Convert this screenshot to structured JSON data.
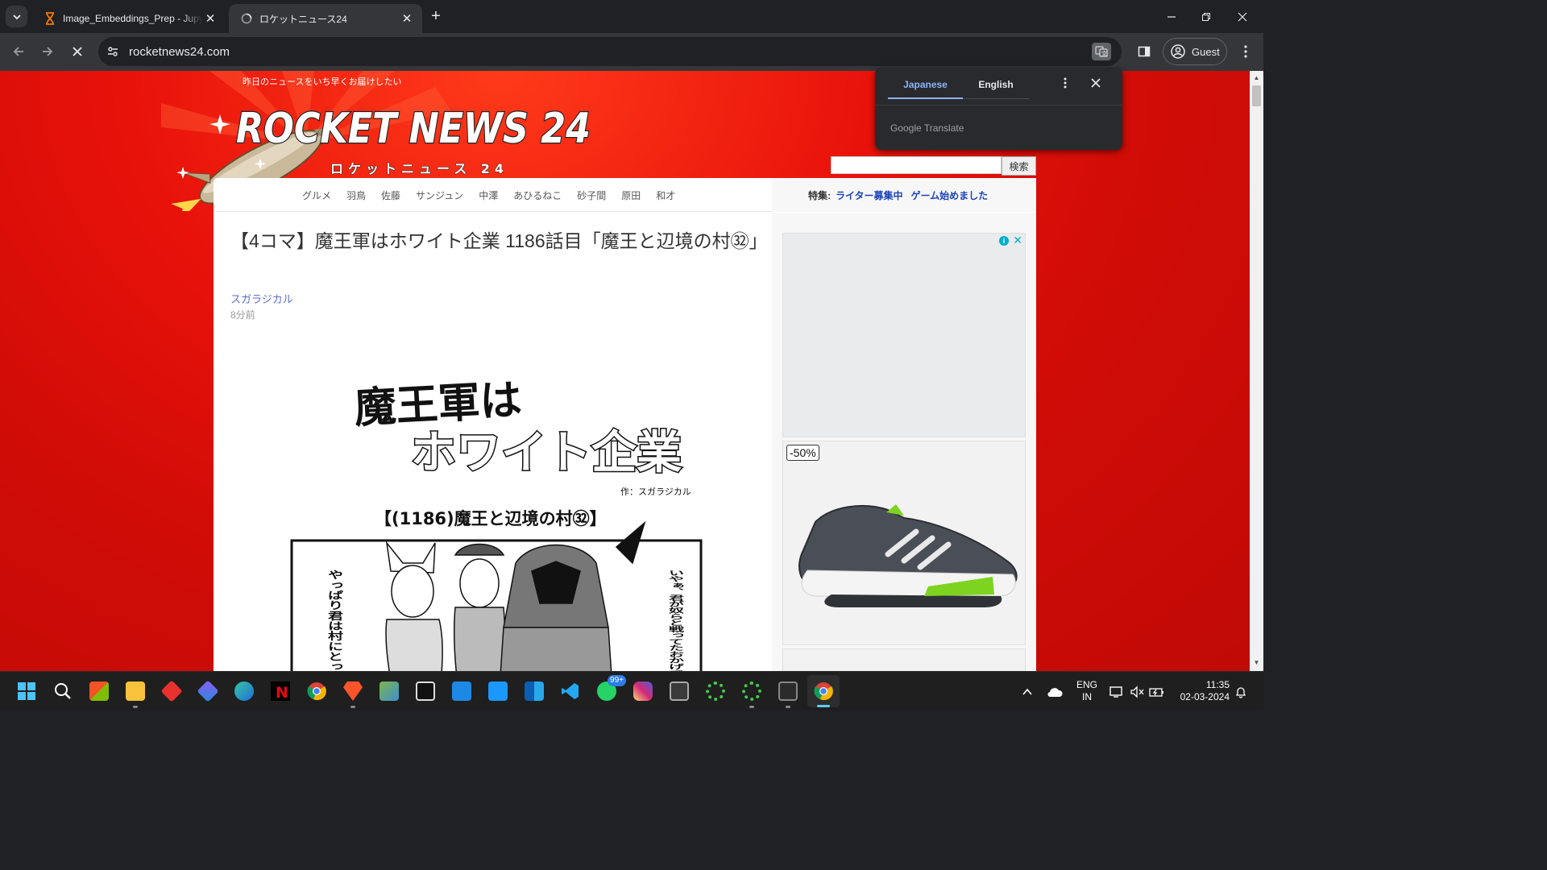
{
  "browser": {
    "tabs": [
      {
        "title": "Image_Embeddings_Prep - Jupyter",
        "active": false
      },
      {
        "title": "ロケットニュース24",
        "active": true
      }
    ],
    "url": "rocketnews24.com",
    "profile_label": "Guest"
  },
  "translate_popup": {
    "source_lang": "Japanese",
    "target_lang": "English",
    "brand": "Google Translate"
  },
  "site": {
    "tagline": "昨日のニュースをいち早くお届けしたい",
    "logo_text": "ROCKET NEWS 24",
    "logo_subtext": "ロケットニュース 24",
    "search_button": "検索",
    "nav_links": [
      "グルメ",
      "羽鳥",
      "佐藤",
      "サンジュン",
      "中澤",
      "あひるねこ",
      "砂子間",
      "原田",
      "和才"
    ],
    "feature_label": "特集:",
    "feature_links": [
      "ライター募集中",
      "ゲーム始めました"
    ]
  },
  "article": {
    "title": "【4コマ】魔王軍はホワイト企業 1186話目「魔王と辺境の村㉜」",
    "author": "スガラジカル",
    "time": "8分前",
    "comic": {
      "series_title_line1": "魔王軍は",
      "series_title_line2": "ホワイト企業",
      "credit": "作：スガラジカル",
      "episode": "【(1186)魔王と辺境の村㉜】",
      "bubble_right": "いやぁ、君が奴らと戦ってたおかげで襲撃を未然に防げたよ",
      "bubble_left": "やっぱり君は村にとって必要な…"
    }
  },
  "ads": {
    "discount": "-50%"
  },
  "taskbar": {
    "lang_line1": "ENG",
    "lang_line2": "IN",
    "time": "11:35",
    "date": "02-03-2024",
    "whatsapp_badge": "99+",
    "apps": [
      "start-icon",
      "search-icon",
      "store-icon",
      "file-explorer-icon",
      "app-red-icon",
      "app-copilot-icon",
      "edge-icon",
      "netflix-icon",
      "chrome-icon",
      "brave-icon",
      "notepad-icon",
      "terminal-icon",
      "app-blue-icon",
      "prime-video-icon",
      "outlook-icon",
      "vscode-icon",
      "whatsapp-icon",
      "instagram-icon",
      "app-window-icon",
      "app-circle-icon",
      "app-circle2-icon",
      "powershell-icon",
      "chrome-active-icon"
    ]
  },
  "colors": {
    "page_red": "#d20c07",
    "link_blue": "#1a43b8",
    "translate_blue": "#8ab4f8"
  }
}
